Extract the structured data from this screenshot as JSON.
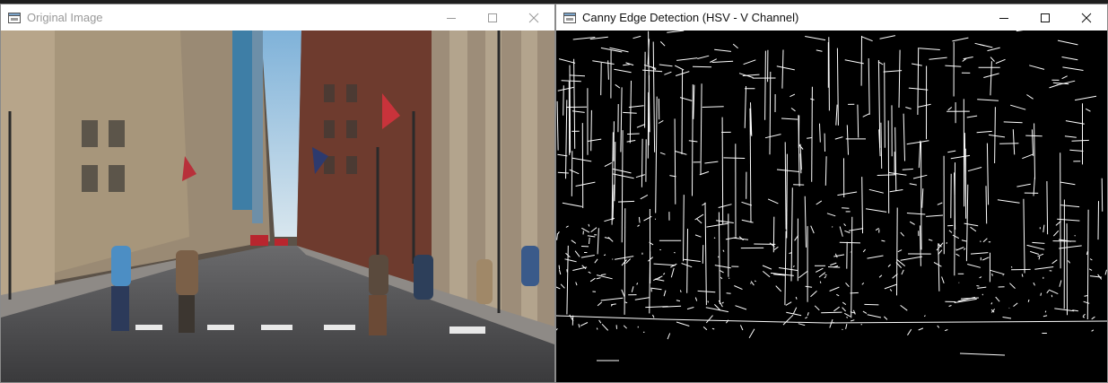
{
  "windows": {
    "left": {
      "title": "Original Image",
      "icon": "image-window-icon",
      "controls": [
        "minimize",
        "maximize",
        "close"
      ]
    },
    "right": {
      "title": "Canny Edge Detection (HSV - V Channel)",
      "icon": "image-window-icon",
      "controls": [
        "minimize",
        "maximize",
        "close"
      ]
    }
  },
  "colors": {
    "titlebar": "#ffffff",
    "inactive_title": "#999999",
    "active_title": "#111111",
    "edge_bg": "#000000",
    "edge_fg": "#ffffff",
    "sky": "#a9c9e0",
    "building_warm": "#8a7a66",
    "building_red": "#6e3b2e",
    "glass_tower": "#3e7ea6",
    "street": "#4a4a4c",
    "sidewalk": "#8e8a86"
  }
}
